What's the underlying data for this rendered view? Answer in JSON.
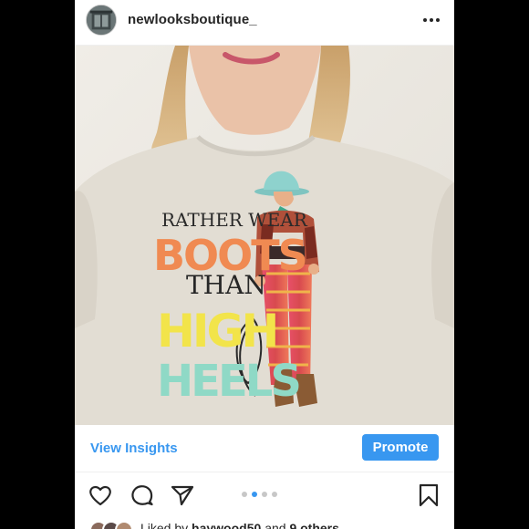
{
  "post": {
    "username": "newlooksboutique_",
    "avatar_icon": "storefront-avatar",
    "more_icon": "more-horizontal-icon"
  },
  "photo": {
    "shirt_print": {
      "line1": "RATHER WEAR",
      "line2": "BOOTS",
      "line3": "THAN",
      "line4": "HIGH",
      "line5": "HEELS"
    }
  },
  "insights": {
    "view_label": "View Insights",
    "promote_label": "Promote"
  },
  "actions": {
    "like_icon": "heart-icon",
    "comment_icon": "comment-icon",
    "share_icon": "send-icon",
    "save_icon": "bookmark-icon",
    "carousel": {
      "total": 4,
      "active": 2
    }
  },
  "likes": {
    "prefix": "Liked by",
    "user": "haywood50",
    "joiner": "and",
    "others": "9 others"
  },
  "colors": {
    "accent": "#3897f0",
    "text": "#262626"
  }
}
